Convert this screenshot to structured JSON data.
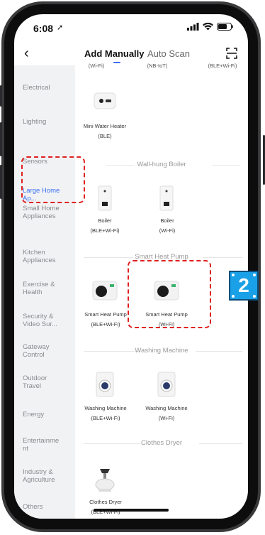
{
  "status_bar": {
    "time": "6:08"
  },
  "nav": {
    "tab_add_manually": "Add Manually",
    "tab_auto_scan": "Auto Scan"
  },
  "sidebar": {
    "items": [
      {
        "label": "Electrical"
      },
      {
        "label": "Lighting"
      },
      {
        "label": "Sensors"
      },
      {
        "label": "Large Home Ap..."
      },
      {
        "label": "Small Home Appliances"
      },
      {
        "label": "Kitchen Appliances"
      },
      {
        "label": "Exercise & Health"
      },
      {
        "label": "Security & Video Sur..."
      },
      {
        "label": "Gateway Control"
      },
      {
        "label": "Outdoor Travel"
      },
      {
        "label": "Energy"
      },
      {
        "label": "Entertainment"
      },
      {
        "label": "Industry & Agriculture"
      },
      {
        "label": "Others"
      }
    ],
    "active": "Large Home Ap..."
  },
  "content": {
    "top_cut_labels": [
      "(Wi-Fi)",
      "(NB-IoT)",
      "(BLE+Wi-Fi)"
    ],
    "mini_water_heater": {
      "name": "Mini Water Heater",
      "conn": "(BLE)"
    },
    "sections": [
      {
        "title": "Wall-hung Boiler",
        "devices": [
          {
            "name": "Boiler",
            "conn": "(BLE+Wi-Fi)"
          },
          {
            "name": "Boiler",
            "conn": "(Wi-Fi)"
          }
        ]
      },
      {
        "title": "Smart Heat Pump",
        "devices": [
          {
            "name": "Smart Heat Pump",
            "conn": "(BLE+Wi-Fi)"
          },
          {
            "name": "Smart Heat Pump",
            "conn": "(Wi-Fi)"
          }
        ]
      },
      {
        "title": "Washing Machine",
        "devices": [
          {
            "name": "Washing Machine",
            "conn": "(BLE+Wi-Fi)"
          },
          {
            "name": "Washing Machine",
            "conn": "(Wi-Fi)"
          }
        ]
      },
      {
        "title": "Clothes Dryer",
        "devices": [
          {
            "name": "Clothes Dryer",
            "conn": "(BLE+Wi-Fi)"
          }
        ]
      }
    ]
  },
  "annotation": {
    "step_number": "2"
  },
  "colors": {
    "accent": "#3b6ef5",
    "highlight": "#e02020",
    "badge": "#1aa0e6"
  }
}
